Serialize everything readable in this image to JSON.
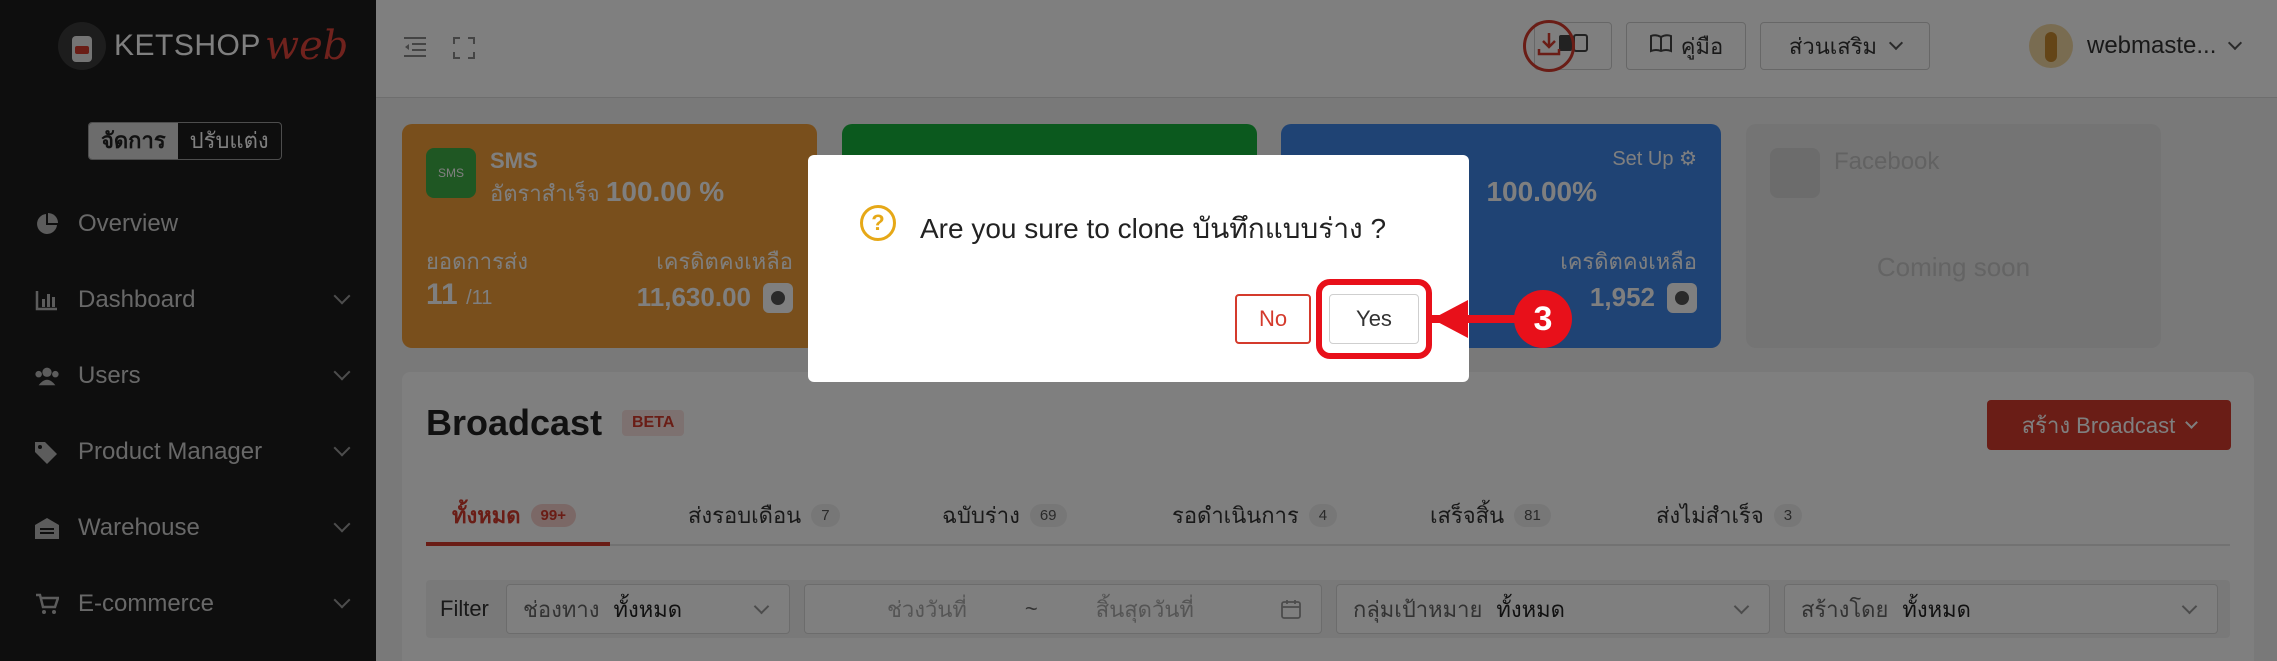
{
  "brand": {
    "name_main": "KETSHOP",
    "name_accent": "web"
  },
  "mode_toggle": {
    "manage": "จัดการ",
    "customize": "ปรับแต่ง"
  },
  "sidebar": {
    "items": [
      {
        "label": "Overview",
        "icon": "pie-chart-icon"
      },
      {
        "label": "Dashboard",
        "icon": "bar-chart-icon"
      },
      {
        "label": "Users",
        "icon": "users-icon"
      },
      {
        "label": "Product Manager",
        "icon": "tag-icon"
      },
      {
        "label": "Warehouse",
        "icon": "warehouse-icon"
      },
      {
        "label": "E-commerce",
        "icon": "cart-icon"
      }
    ]
  },
  "topbar": {
    "manual_label": "คู่มือ",
    "addons_label": "ส่วนเสริม",
    "username": "webmaste..."
  },
  "cards": {
    "sms": {
      "title": "SMS",
      "rate_label": "อัตราสำเร็จ",
      "rate_value": "100.00 %",
      "sent_label": "ยอดการส่ง",
      "sent_value": "11",
      "sent_total": "/11",
      "credit_label": "เครดิตคงเหลือ",
      "credit_value": "11,630.00"
    },
    "email": {
      "setup_label": "Set Up",
      "rate_value": "100.00%",
      "credit_label": "เครดิตคงเหลือ",
      "credit_value": "1,952"
    },
    "facebook": {
      "title": "Facebook",
      "status": "Coming soon"
    }
  },
  "broadcast": {
    "title": "Broadcast",
    "badge": "BETA",
    "create_button": "สร้าง Broadcast",
    "tabs": [
      {
        "label": "ทั้งหมด",
        "count": "99+"
      },
      {
        "label": "ส่งรอบเดือน",
        "count": "7"
      },
      {
        "label": "ฉบับร่าง",
        "count": "69"
      },
      {
        "label": "รอดำเนินการ",
        "count": "4"
      },
      {
        "label": "เสร็จสิ้น",
        "count": "81"
      },
      {
        "label": "ส่งไม่สำเร็จ",
        "count": "3"
      }
    ],
    "filter": {
      "label": "Filter",
      "channel_label": "ช่องทาง",
      "channel_value": "ทั้งหมด",
      "date_start_placeholder": "ช่วงวันที่",
      "date_sep": "~",
      "date_end_placeholder": "สิ้นสุดวันที่",
      "target_label": "กลุ่มเป้าหมาย",
      "target_value": "ทั้งหมด",
      "creator_label": "สร้างโดย",
      "creator_value": "ทั้งหมด"
    }
  },
  "modal": {
    "message": "Are you sure to clone บันทึกแบบร่าง ?",
    "no_label": "No",
    "yes_label": "Yes"
  },
  "annotation": {
    "step": "3"
  },
  "colors": {
    "brand_red": "#d43a2c",
    "sms_card": "#f29f38",
    "line_card": "#17b33c",
    "email_card": "#3f86e8",
    "annotation_red": "#e8101a",
    "question_icon": "#e6a817"
  }
}
